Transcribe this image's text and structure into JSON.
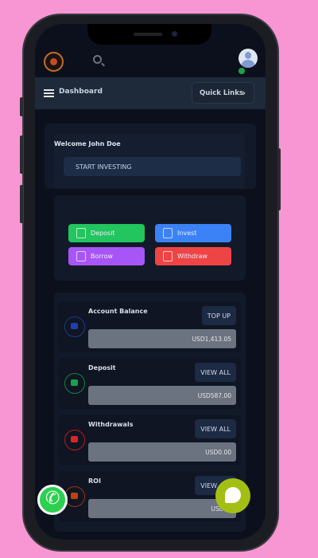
{
  "header": {
    "title": "Dashboard",
    "quick_links": "Quick Links",
    "chevron": "›"
  },
  "welcome": {
    "text": "Welcome John Doe",
    "cta": "START INVESTING"
  },
  "actions": [
    {
      "label": "Deposit",
      "color": "#22c55e"
    },
    {
      "label": "Invest",
      "color": "#3b82f6"
    },
    {
      "label": "Borrow",
      "color": "#a855f7"
    },
    {
      "label": "Withdraw",
      "color": "#ef4444"
    }
  ],
  "stats": [
    {
      "title": "Account Balance",
      "button": "TOP UP",
      "value": "USD1,413.05",
      "icon": "wallet-icon",
      "color": "#1e40af"
    },
    {
      "title": "Deposit",
      "button": "VIEW ALL",
      "value": "USD587.00",
      "icon": "deposit-icon",
      "color": "#16a34a"
    },
    {
      "title": "Withdrawals",
      "button": "VIEW ALL",
      "value": "USD0.00",
      "icon": "withdraw-icon",
      "color": "#dc2626"
    },
    {
      "title": "ROI",
      "button": "VIEW ALL",
      "value": "USD31",
      "icon": "coins-icon",
      "color": "#c2410c"
    }
  ]
}
